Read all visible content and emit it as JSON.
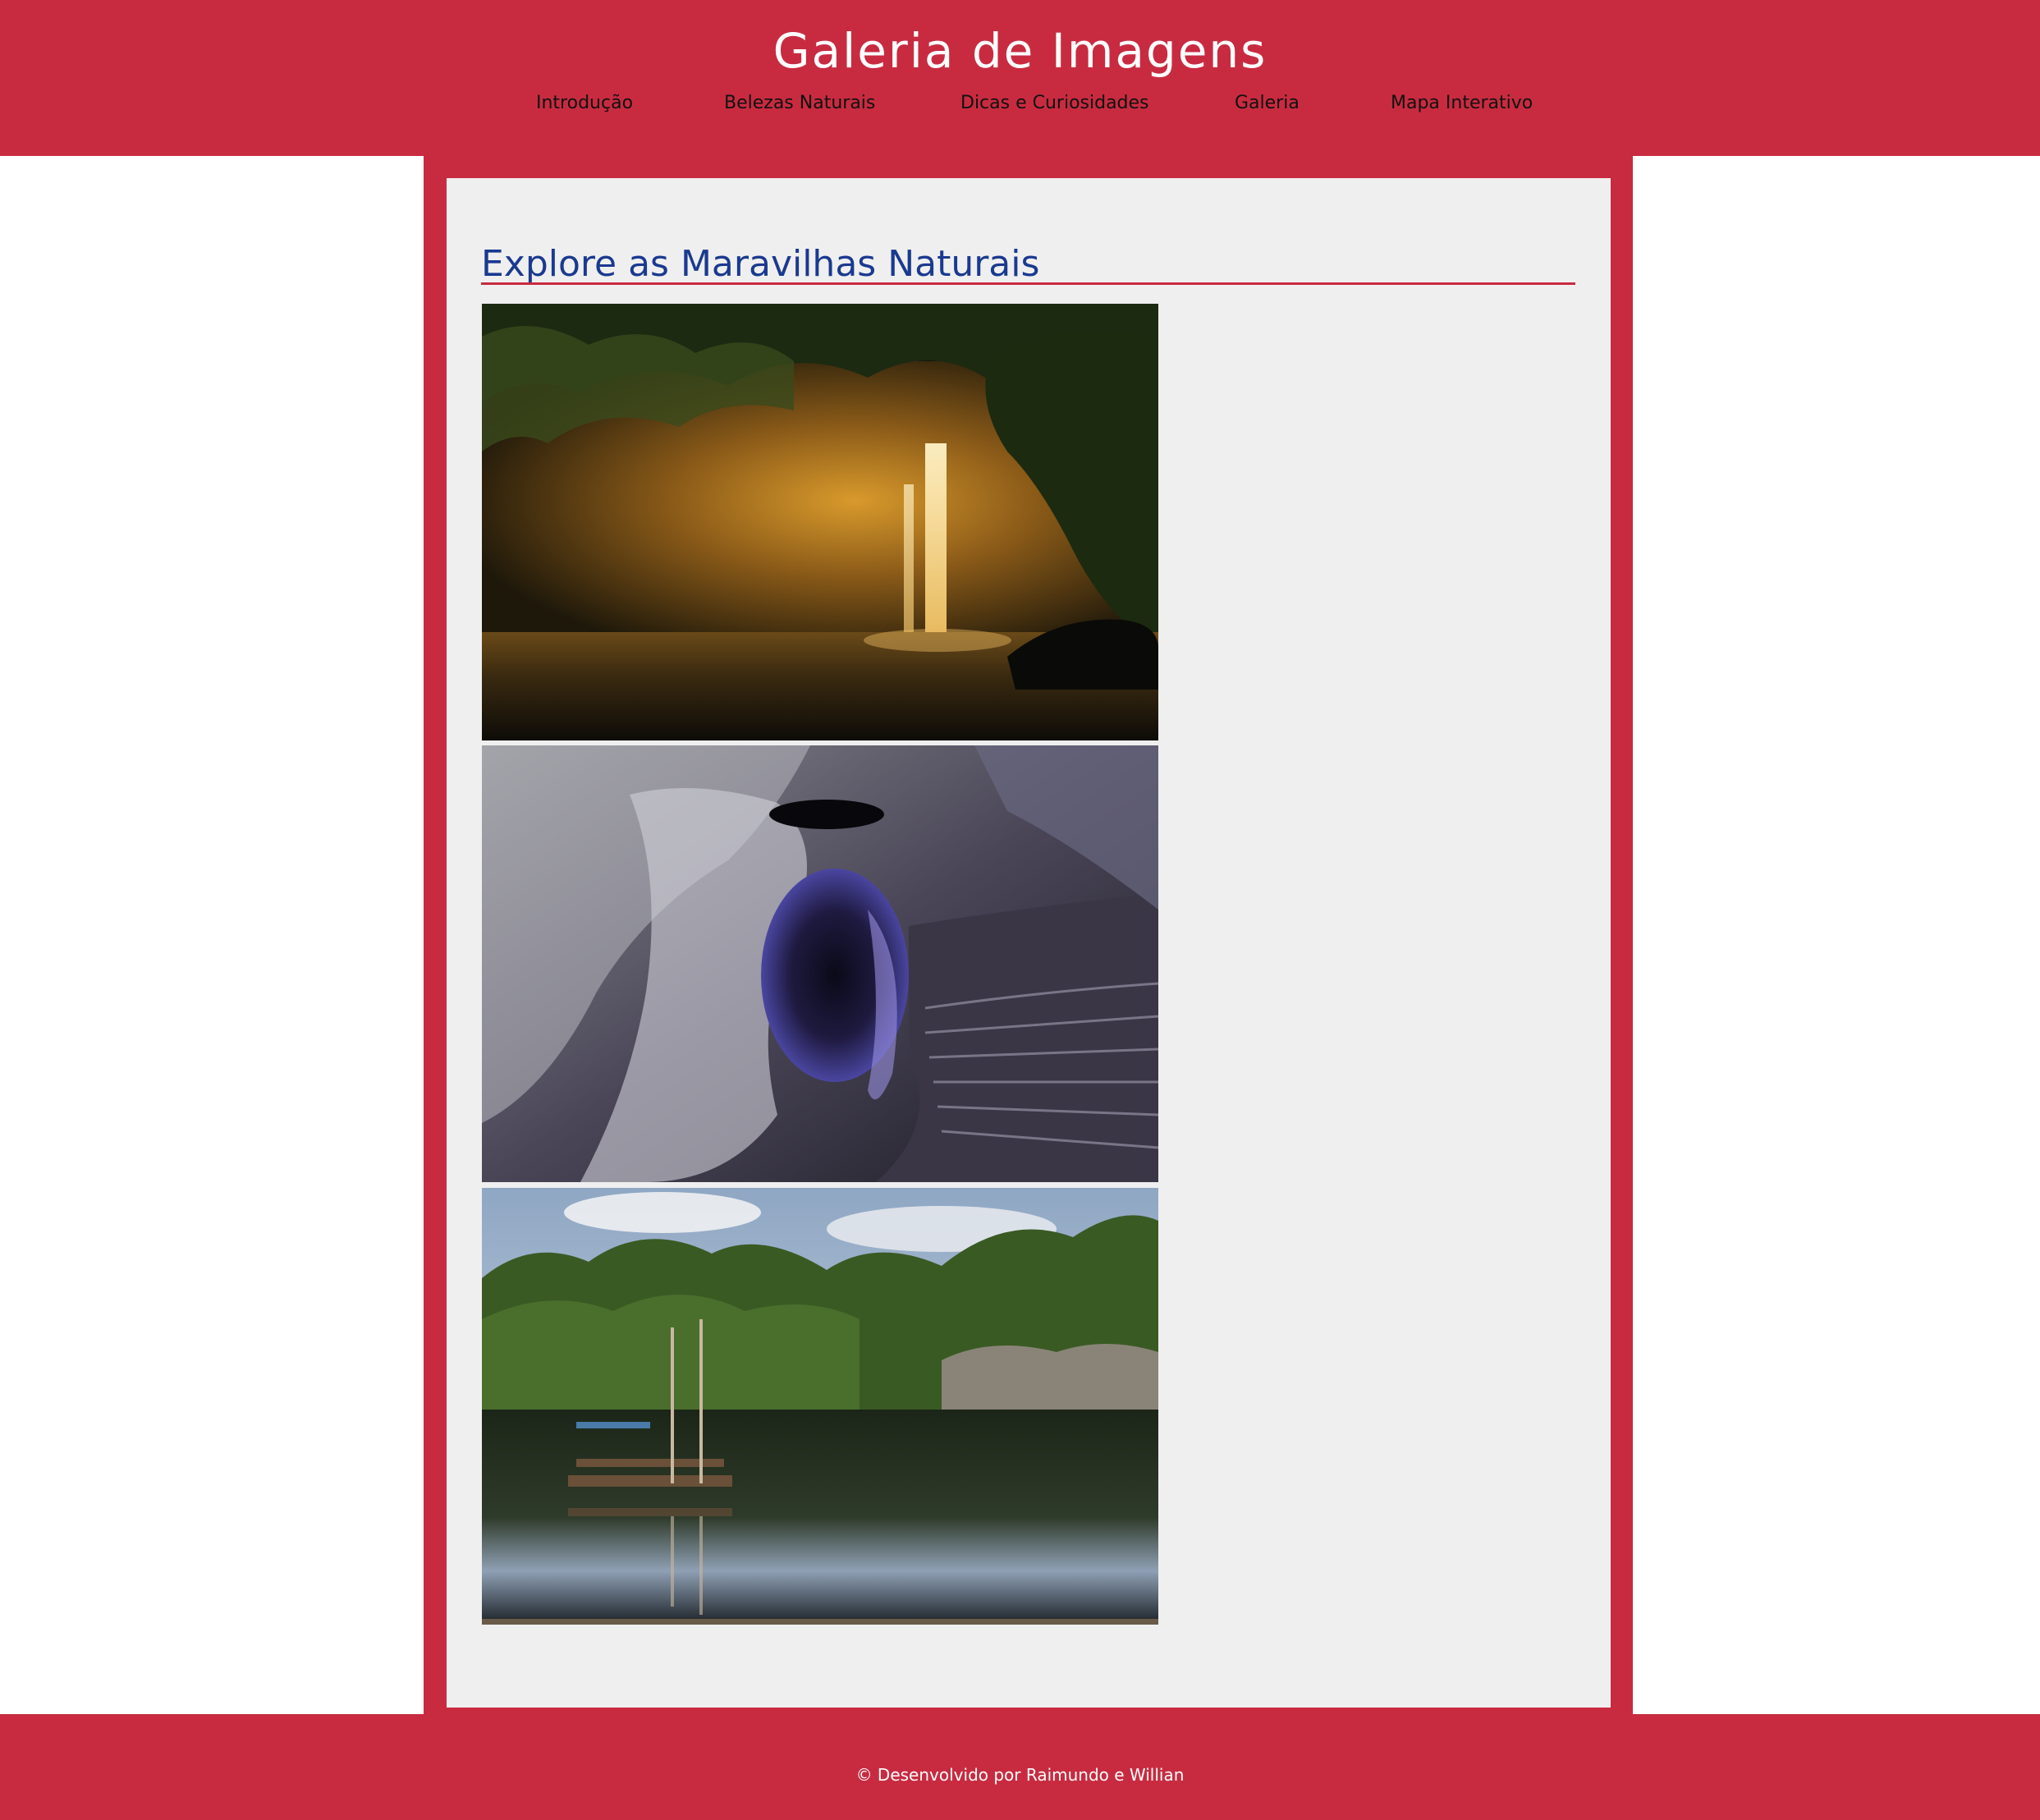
{
  "header": {
    "title": "Galeria de Imagens",
    "nav": [
      {
        "label": "Introdução"
      },
      {
        "label": "Belezas Naturais"
      },
      {
        "label": "Dicas e Curiosidades"
      },
      {
        "label": "Galeria"
      },
      {
        "label": "Mapa Interativo"
      }
    ]
  },
  "main": {
    "heading": "Explore as Maravilhas Naturais",
    "images": [
      {
        "subject": "waterfall at night"
      },
      {
        "subject": "lava cave"
      },
      {
        "subject": "lagoon with wooden raft"
      }
    ]
  },
  "footer": {
    "text": "© Desenvolvido por Raimundo e Willian"
  },
  "colors": {
    "brand_red": "#c82b40",
    "heading_blue": "#1a3a8f",
    "panel_gray": "#efefef"
  }
}
